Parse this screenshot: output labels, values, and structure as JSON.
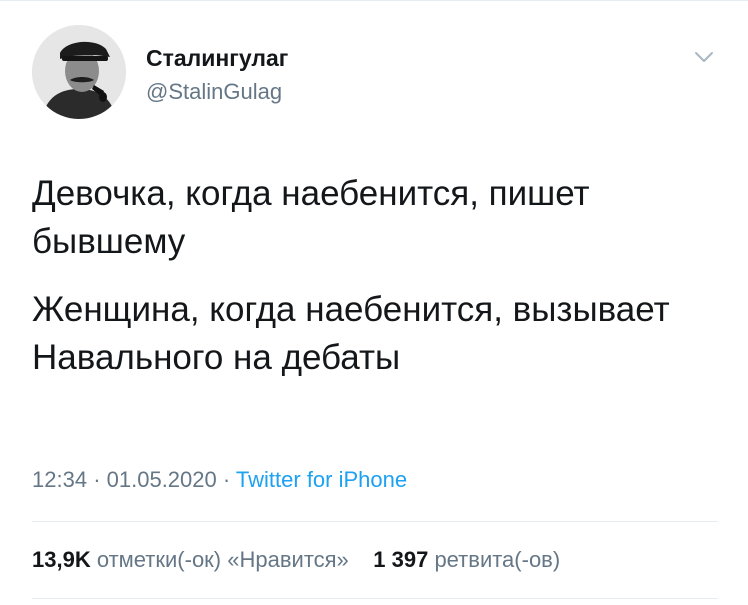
{
  "author": {
    "display_name": "Сталингулаг",
    "handle": "@StalinGulag",
    "avatar_icon": "portrait-avatar"
  },
  "menu_icon": "chevron-down-icon",
  "tweet": {
    "paragraphs": [
      "Девочка, когда наебенится, пишет бывшему",
      "Женщина, когда наебенится, вызывает Навального на дебаты"
    ]
  },
  "meta": {
    "time": "12:34",
    "date": "01.05.2020",
    "separator": "·",
    "source": "Twitter for iPhone"
  },
  "stats": {
    "likes_count": "13,9K",
    "likes_label": "отметки(-ок) «Нравится»",
    "retweets_count": "1 397",
    "retweets_label": "ретвита(-ов)"
  },
  "colors": {
    "text": "#14171a",
    "secondary": "#657786",
    "link": "#1da1f2",
    "divider": "#e6ecf0"
  }
}
